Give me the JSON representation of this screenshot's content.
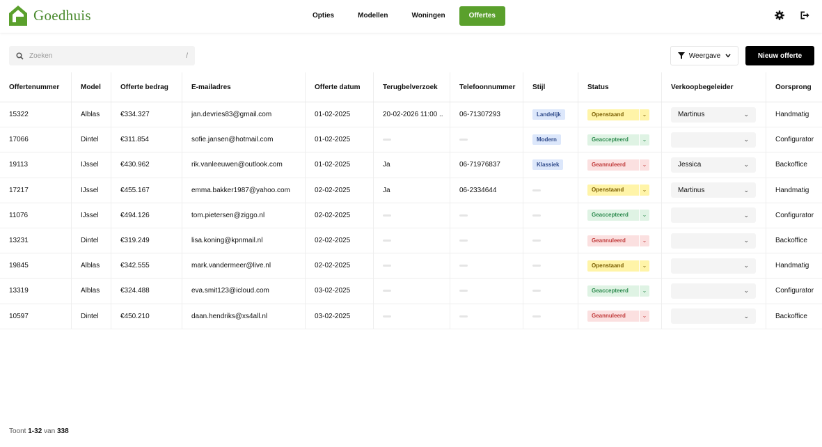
{
  "brand": {
    "name": "Goedhuis",
    "color": "#4a8a2e"
  },
  "nav": {
    "items": [
      {
        "label": "Opties",
        "active": false
      },
      {
        "label": "Modellen",
        "active": false
      },
      {
        "label": "Woningen",
        "active": false
      },
      {
        "label": "Offertes",
        "active": true
      }
    ]
  },
  "header_icons": [
    "gear-icon",
    "logout-icon"
  ],
  "search": {
    "placeholder": "Zoeken",
    "shortcut": "/"
  },
  "toolbar": {
    "view_label": "Weergave",
    "new_label": "Nieuw offerte"
  },
  "table": {
    "columns": [
      "Offertenummer",
      "Model",
      "Offerte bedrag",
      "E-mailadres",
      "Offerte datum",
      "Terugbelverzoek",
      "Telefoonnummer",
      "Stijl",
      "Status",
      "Verkoopbegeleider",
      "Oorsprong"
    ],
    "rows": [
      {
        "nr": "15322",
        "model": "Alblas",
        "bedrag": "€334.327",
        "email": "jan.devries83@gmail.com",
        "datum": "01-02-2025",
        "terug": "20-02-2026 11:00 ..",
        "tel": "06-71307293",
        "stijl": "Landelijk",
        "status": "Openstaand",
        "begeleider": "Martinus",
        "oorsprong": "Handmatig"
      },
      {
        "nr": "17066",
        "model": "Dintel",
        "bedrag": "€311.854",
        "email": "sofie.jansen@hotmail.com",
        "datum": "01-02-2025",
        "terug": "",
        "tel": "",
        "stijl": "Modern",
        "status": "Geaccepteerd",
        "begeleider": "",
        "oorsprong": "Configurator"
      },
      {
        "nr": "19113",
        "model": "IJssel",
        "bedrag": "€430.962",
        "email": "rik.vanleeuwen@outlook.com",
        "datum": "01-02-2025",
        "terug": "Ja",
        "tel": "06-71976837",
        "stijl": "Klassiek",
        "status": "Geannuleerd",
        "begeleider": "Jessica",
        "oorsprong": "Backoffice"
      },
      {
        "nr": "17217",
        "model": "IJssel",
        "bedrag": "€455.167",
        "email": "emma.bakker1987@yahoo.com",
        "datum": "02-02-2025",
        "terug": "Ja",
        "tel": "06-2334644",
        "stijl": "",
        "status": "Openstaand",
        "begeleider": "Martinus",
        "oorsprong": "Handmatig"
      },
      {
        "nr": "11076",
        "model": "IJssel",
        "bedrag": "€494.126",
        "email": "tom.pietersen@ziggo.nl",
        "datum": "02-02-2025",
        "terug": "",
        "tel": "",
        "stijl": "",
        "status": "Geaccepteerd",
        "begeleider": "",
        "oorsprong": "Configurator"
      },
      {
        "nr": "13231",
        "model": "Dintel",
        "bedrag": "€319.249",
        "email": "lisa.koning@kpnmail.nl",
        "datum": "02-02-2025",
        "terug": "",
        "tel": "",
        "stijl": "",
        "status": "Geannuleerd",
        "begeleider": "",
        "oorsprong": "Backoffice"
      },
      {
        "nr": "19845",
        "model": "Alblas",
        "bedrag": "€342.555",
        "email": "mark.vandermeer@live.nl",
        "datum": "02-02-2025",
        "terug": "",
        "tel": "",
        "stijl": "",
        "status": "Openstaand",
        "begeleider": "",
        "oorsprong": "Handmatig"
      },
      {
        "nr": "13319",
        "model": "Alblas",
        "bedrag": "€324.488",
        "email": "eva.smit123@icloud.com",
        "datum": "03-02-2025",
        "terug": "",
        "tel": "",
        "stijl": "",
        "status": "Geaccepteerd",
        "begeleider": "",
        "oorsprong": "Configurator"
      },
      {
        "nr": "10597",
        "model": "Dintel",
        "bedrag": "€450.210",
        "email": "daan.hendriks@xs4all.nl",
        "datum": "03-02-2025",
        "terug": "",
        "tel": "",
        "stijl": "",
        "status": "Geannuleerd",
        "begeleider": "",
        "oorsprong": "Backoffice"
      }
    ]
  },
  "footer": {
    "prefix": "Toont",
    "range": "1-32",
    "middle": "van",
    "total": "338"
  },
  "colors": {
    "accent": "#5aa02c",
    "open": "#fff4a8",
    "accepted": "#dff3e4",
    "cancelled": "#fbe0e0",
    "style_badge": "#dce7fb"
  }
}
